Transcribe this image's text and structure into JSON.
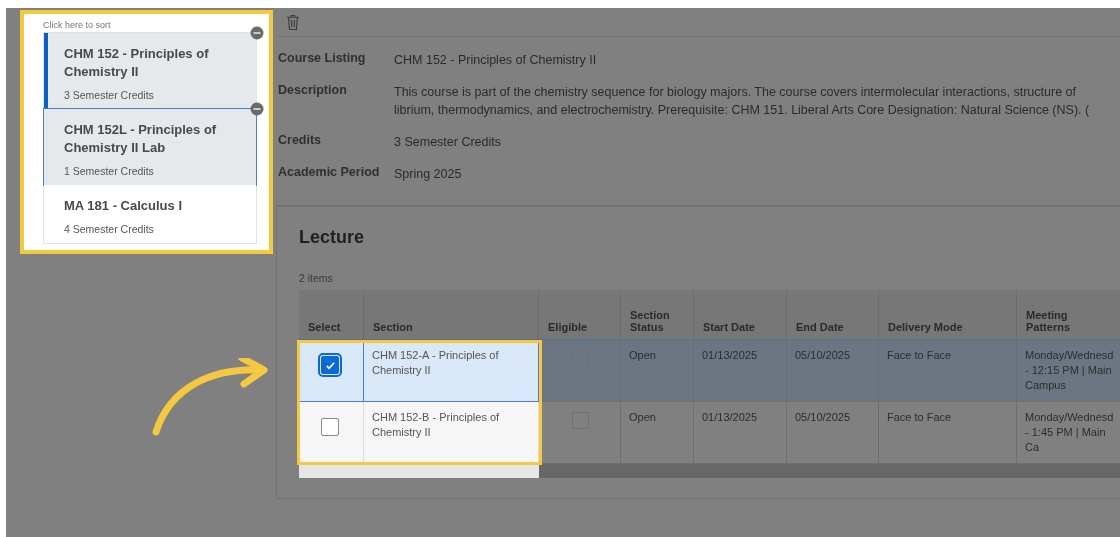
{
  "sort_hint": "Click here to sort",
  "courses": [
    {
      "title": "CHM 152 - Principles of Chemistry II",
      "credits": "3 Semester Credits",
      "selected": true,
      "hovered": false
    },
    {
      "title": "CHM 152L - Principles of Chemistry II Lab",
      "credits": "1 Semester Credits",
      "selected": false,
      "hovered": true
    },
    {
      "title": "MA 181 - Calculus I",
      "credits": "4 Semester Credits",
      "selected": false,
      "hovered": false
    }
  ],
  "details": [
    {
      "label": "Course Listing",
      "lines": [
        "CHM 152 - Principles of Chemistry II"
      ]
    },
    {
      "label": "Description",
      "lines": [
        "This course is part of the chemistry sequence for biology majors. The course covers intermolecular interactions, structure of",
        "librium, thermodynamics, and electrochemistry. Prerequisite: CHM 151. Liberal Arts Core Designation: Natural Science (NS). ("
      ]
    },
    {
      "label": "Credits",
      "lines": [
        "3 Semester Credits"
      ]
    },
    {
      "label": "Academic Period",
      "lines": [
        "Spring 2025"
      ]
    }
  ],
  "lecture": {
    "title": "Lecture",
    "count": "2 items",
    "columns": [
      "Select",
      "Section",
      "Eligible",
      "Section Status",
      "Start Date",
      "End Date",
      "Delivery Mode",
      "Meeting Patterns"
    ],
    "rows": [
      {
        "selected": true,
        "section": "CHM 152-A - Principles of Chemistry II",
        "eligible": false,
        "status": "Open",
        "start": "01/13/2025",
        "end": "05/10/2025",
        "mode": "Face to Face",
        "meeting": "Monday/Wednesd - 12:15 PM | Main Campus"
      },
      {
        "selected": false,
        "section": "CHM 152-B - Principles of Chemistry II",
        "eligible": false,
        "status": "Open",
        "start": "01/13/2025",
        "end": "05/10/2025",
        "mode": "Face to Face",
        "meeting": "Monday/Wednesd - 1:45 PM | Main Ca"
      }
    ]
  }
}
